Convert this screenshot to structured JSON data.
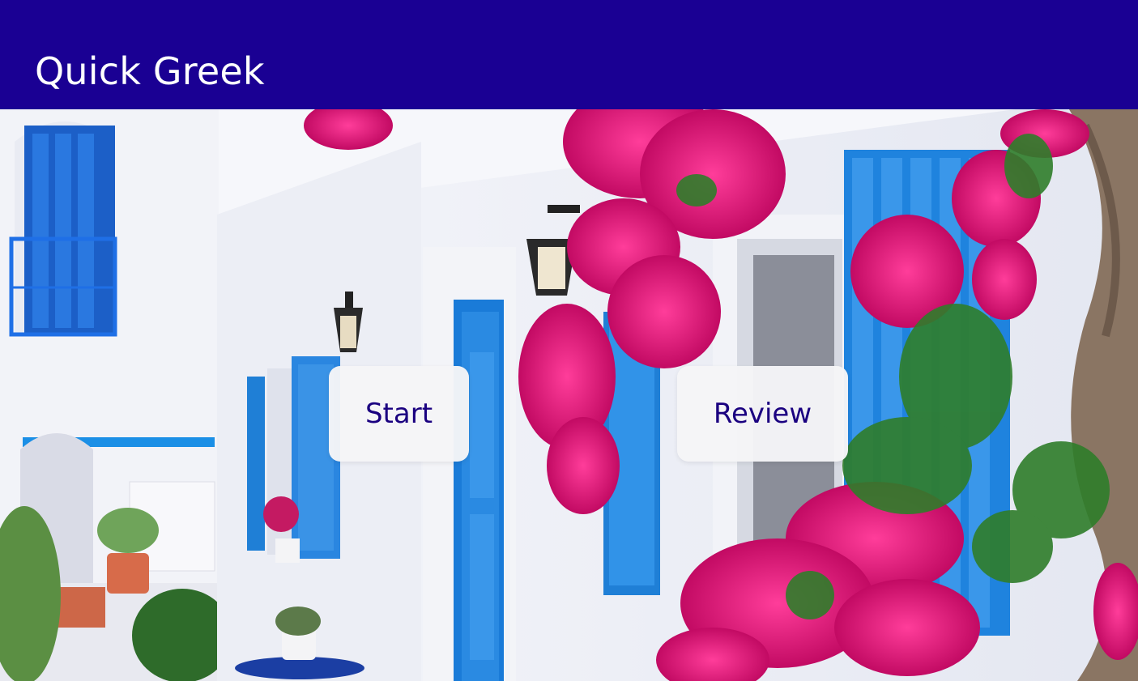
{
  "header": {
    "title": "Quick Greek"
  },
  "hero": {
    "image": "greek-island-house-with-blue-shutters-and-bougainvillea"
  },
  "actions": {
    "start_label": "Start",
    "review_label": "Review"
  },
  "colors": {
    "header_bg": "#1a0093",
    "button_text": "#1a0080",
    "button_bg": "#f5f5f7",
    "shutter_blue": "#1f7fd6",
    "bougainvillea": "#e0157a"
  }
}
